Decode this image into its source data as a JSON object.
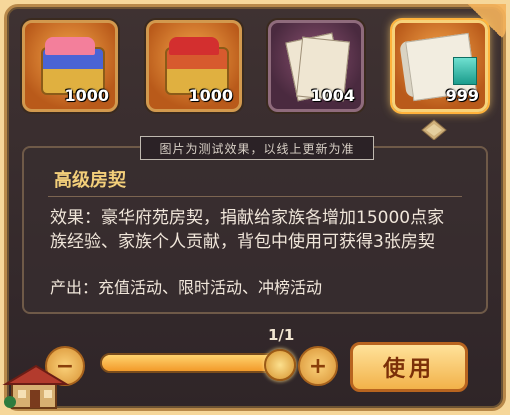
{
  "items": [
    {
      "qty": "1000",
      "style": "orange",
      "selected": false
    },
    {
      "qty": "1000",
      "style": "orange",
      "selected": false
    },
    {
      "qty": "1004",
      "style": "purple",
      "selected": false
    },
    {
      "qty": "999",
      "style": "orange",
      "selected": true
    }
  ],
  "caption": "图片为测试效果，以线上更新为准",
  "item_title": "高级房契",
  "effect_text": "效果：豪华府苑房契，捐献给家族各增加15000点家族经验、家族个人贡献，背包中使用可获得3张房契",
  "origin_text": "产出：充值活动、限时活动、冲榜活动",
  "counter_text": "1/1",
  "use_button_label": "使用",
  "slider_fraction": 1
}
